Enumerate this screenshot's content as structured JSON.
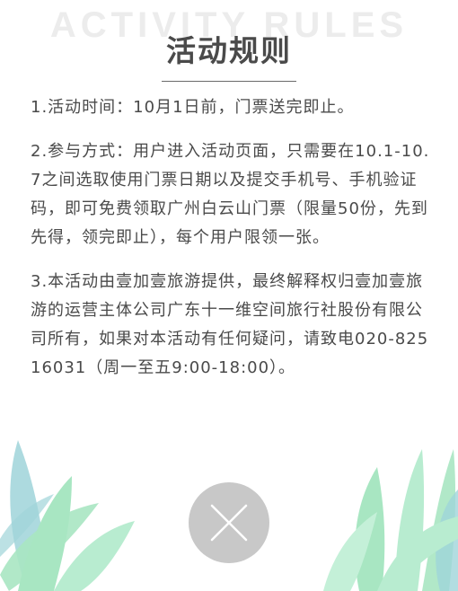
{
  "header": {
    "bg_title": "ACTIVITY RULES",
    "title": "活动规则"
  },
  "rules": [
    "1.活动时间：10月1日前，门票送完即止。",
    "2.参与方式：用户进入活动页面，只需要在10.1-10.7之间选取使用门票日期以及提交手机号、手机验证码，即可免费领取广州白云山门票（限量50份，先到先得，领完即止），每个用户限领一张。",
    "3.本活动由壹加壹旅游提供，最终解释权归壹加壹旅游的运营主体公司广东十一维空间旅行社股份有限公司所有，如果对本活动有任何疑问，请致电020-82516031（周一至五9:00-18:00）。"
  ],
  "close_button": {
    "icon": "close-icon"
  },
  "colors": {
    "title": "#4a4a4a",
    "bg_title": "#ececec",
    "text": "#4a4a4a",
    "close_bg": "#c8c8c8",
    "leaf_green": "#a8e6c2",
    "leaf_blue": "#9fd4d9"
  }
}
